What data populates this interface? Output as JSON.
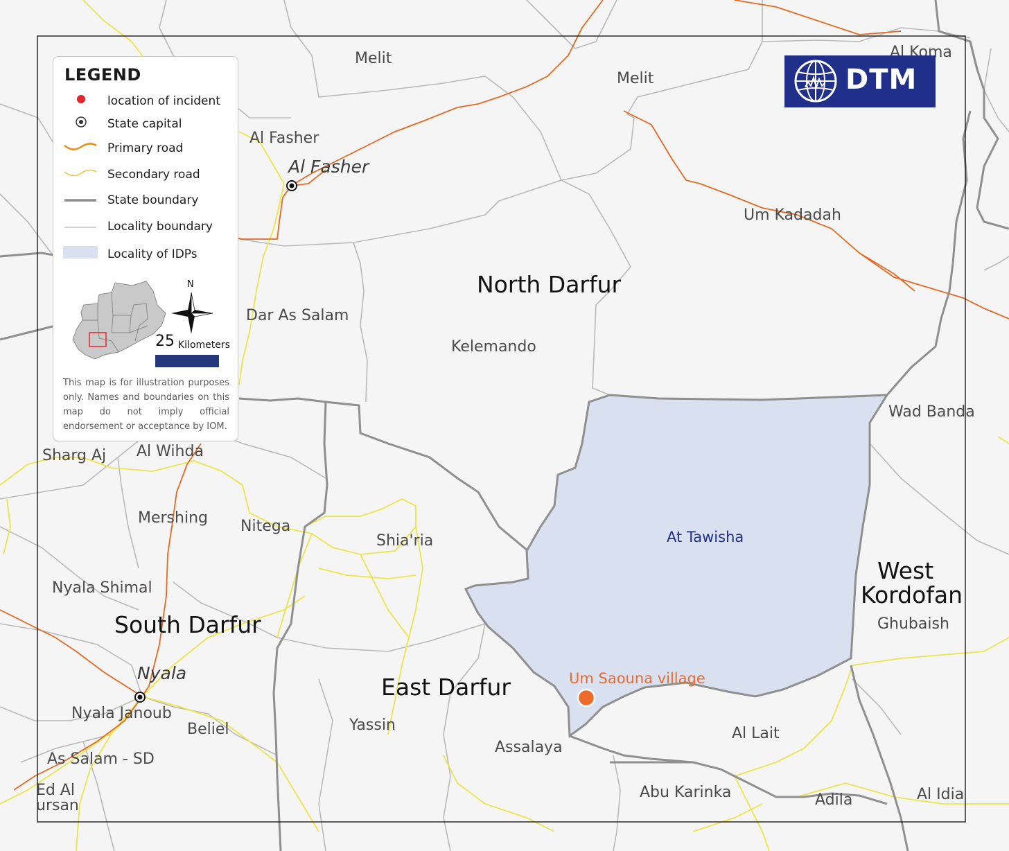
{
  "colors": {
    "background": "#f4f5f4",
    "idp_fill": "#d9e1f1",
    "incident": "#ec6b2a",
    "primary_road": "#e56a21",
    "secondary_road": "#f0e63a",
    "state_boundary": "#8c8c8c",
    "locality_boundary": "#b8b8b8",
    "dtm_blue": "#1f2f8a"
  },
  "legend": {
    "title": "LEGEND",
    "items": [
      {
        "symbol": "red-dot-icon",
        "label": "location of incident"
      },
      {
        "symbol": "state-capital-icon",
        "label": "State capital"
      },
      {
        "symbol": "primary-road-line",
        "label": "Primary road"
      },
      {
        "symbol": "secondary-road-line",
        "label": "Secondary road"
      },
      {
        "symbol": "state-boundary-line",
        "label": "State boundary"
      },
      {
        "symbol": "locality-boundary-line",
        "label": "Locality boundary"
      },
      {
        "symbol": "idp-locality-swatch",
        "label": "Locality of IDPs"
      }
    ],
    "north_label": "N",
    "scale_value": "25",
    "scale_unit": "Kilometers",
    "disclaimer": "This map is for illustration purposes only. Names and boundaries on this map do not imply official endorsement or acceptance by IOM."
  },
  "logo": {
    "text": "DTM"
  },
  "map": {
    "states": [
      "North Darfur",
      "South Darfur",
      "East Darfur",
      "West",
      "Kordofan"
    ],
    "capitals": [
      "Al Fasher",
      "Nyala"
    ],
    "localities": [
      "Melit",
      "Melit",
      "Al Koma",
      "Al Fasher",
      "Um Kadadah",
      "Dar As Salam",
      "Kelemando",
      "Wad Banda",
      "Sharg Aj",
      "Al Wihda",
      "Mershing",
      "Nitega",
      "Shia'ria",
      "Nyala Shimal",
      "Ghubaish",
      "Nyala Janoub",
      "Beliel",
      "Yassin",
      "Assalaya",
      "Al Lait",
      "As Salam - SD",
      "Abu Karinka",
      "Adila",
      "Al Idia",
      "Ed Al",
      "ursan"
    ],
    "idp_locality": "At Tawisha",
    "incident_label": "Um Saouna village"
  }
}
